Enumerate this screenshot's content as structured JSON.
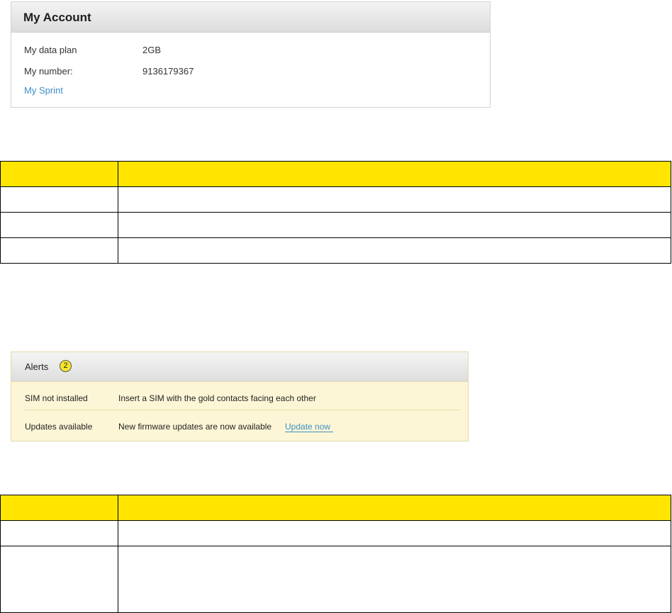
{
  "account": {
    "title": "My Account",
    "rows": [
      {
        "label": "My data plan",
        "value": "2GB"
      },
      {
        "label": "My number:",
        "value": "9136179367"
      }
    ],
    "link": "My Sprint"
  },
  "alerts": {
    "title": "Alerts",
    "badge": "2",
    "items": [
      {
        "name": "SIM not installed",
        "message": "Insert a SIM with the gold contacts facing each other",
        "action": ""
      },
      {
        "name": "Updates available",
        "message": "New firmware updates are now available",
        "action": "Update now"
      }
    ]
  },
  "colors": {
    "table_header": "#ffe500",
    "link": "#3e8fc5",
    "alert_background": "#fdf6d6"
  }
}
